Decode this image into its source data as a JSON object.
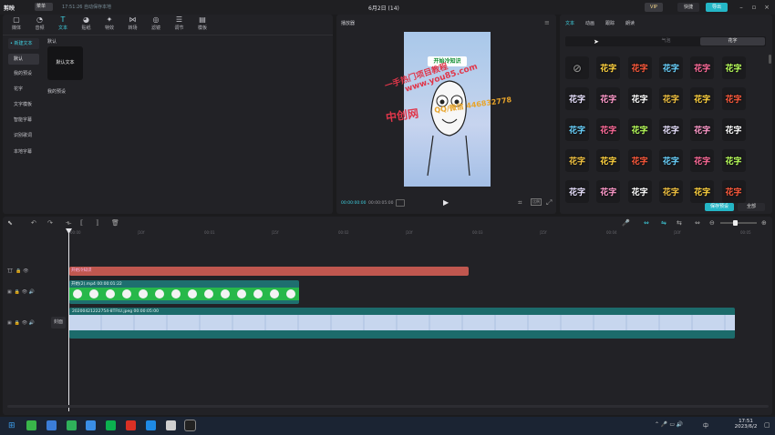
{
  "titlebar": {
    "app_name": "剪映",
    "menu": "菜单",
    "autosave": "17:51:26 自动保存本地",
    "project": "6月2日 (14)",
    "vip": "VIP",
    "shortcut": "快捷",
    "export": "导出"
  },
  "toolbar": {
    "items": [
      {
        "label": "媒体",
        "icon": "▢"
      },
      {
        "label": "音频",
        "icon": "◔"
      },
      {
        "label": "文本",
        "icon": "T"
      },
      {
        "label": "贴纸",
        "icon": "◕"
      },
      {
        "label": "特效",
        "icon": "✦"
      },
      {
        "label": "转场",
        "icon": "⋈"
      },
      {
        "label": "滤镜",
        "icon": "◎"
      },
      {
        "label": "调节",
        "icon": "☰"
      },
      {
        "label": "模板",
        "icon": "▤"
      }
    ]
  },
  "text_panel": {
    "sidebar": [
      "• 新建文本",
      "默认",
      "我的预设",
      "花字",
      "文字模板",
      "智能字幕",
      "识别歌词",
      "本地字幕"
    ],
    "section_default": "默认",
    "default_card": "默认文本",
    "section_presets": "我的预设"
  },
  "player": {
    "title": "播放器",
    "video_text": "开始冷知识",
    "time_current": "00:00:00:00",
    "time_total": "00:00:05:00",
    "ratio_icon": "比例"
  },
  "watermark": {
    "line1": "一手热门项目教程",
    "line2": "www.you85.com",
    "line3": "中创网",
    "line4": "QQ/微信 446832778"
  },
  "right_panel": {
    "tabs": [
      "文本",
      "动画",
      "跟踪",
      "朗读"
    ],
    "subtabs": [
      "",
      "气泡",
      "花字"
    ],
    "sticker_text": "花字",
    "save_preset": "保存预设",
    "apply_all": "全部"
  },
  "timeline": {
    "ticks": [
      "00:00",
      "|10f",
      "00:01",
      "|15f",
      "00:02",
      "|10f",
      "00:03",
      "|15f",
      "00:04",
      "|10f",
      "00:05"
    ],
    "text_clip": "开始冷知识",
    "sticker_clip": "开始(2).mp4  00:00:01:22",
    "video_clip": "20200421222754-8TFtU.jpeg  00:00:05:00",
    "cover": "封面"
  },
  "taskbar": {
    "time": "17:51",
    "date": "2023/6/2",
    "lang": "中"
  },
  "colors": {
    "accent": "#3fd0e0",
    "text_clip": "#c0574f",
    "sticker_clip": "#27b84a",
    "video_clip": "#1c6b6b"
  }
}
